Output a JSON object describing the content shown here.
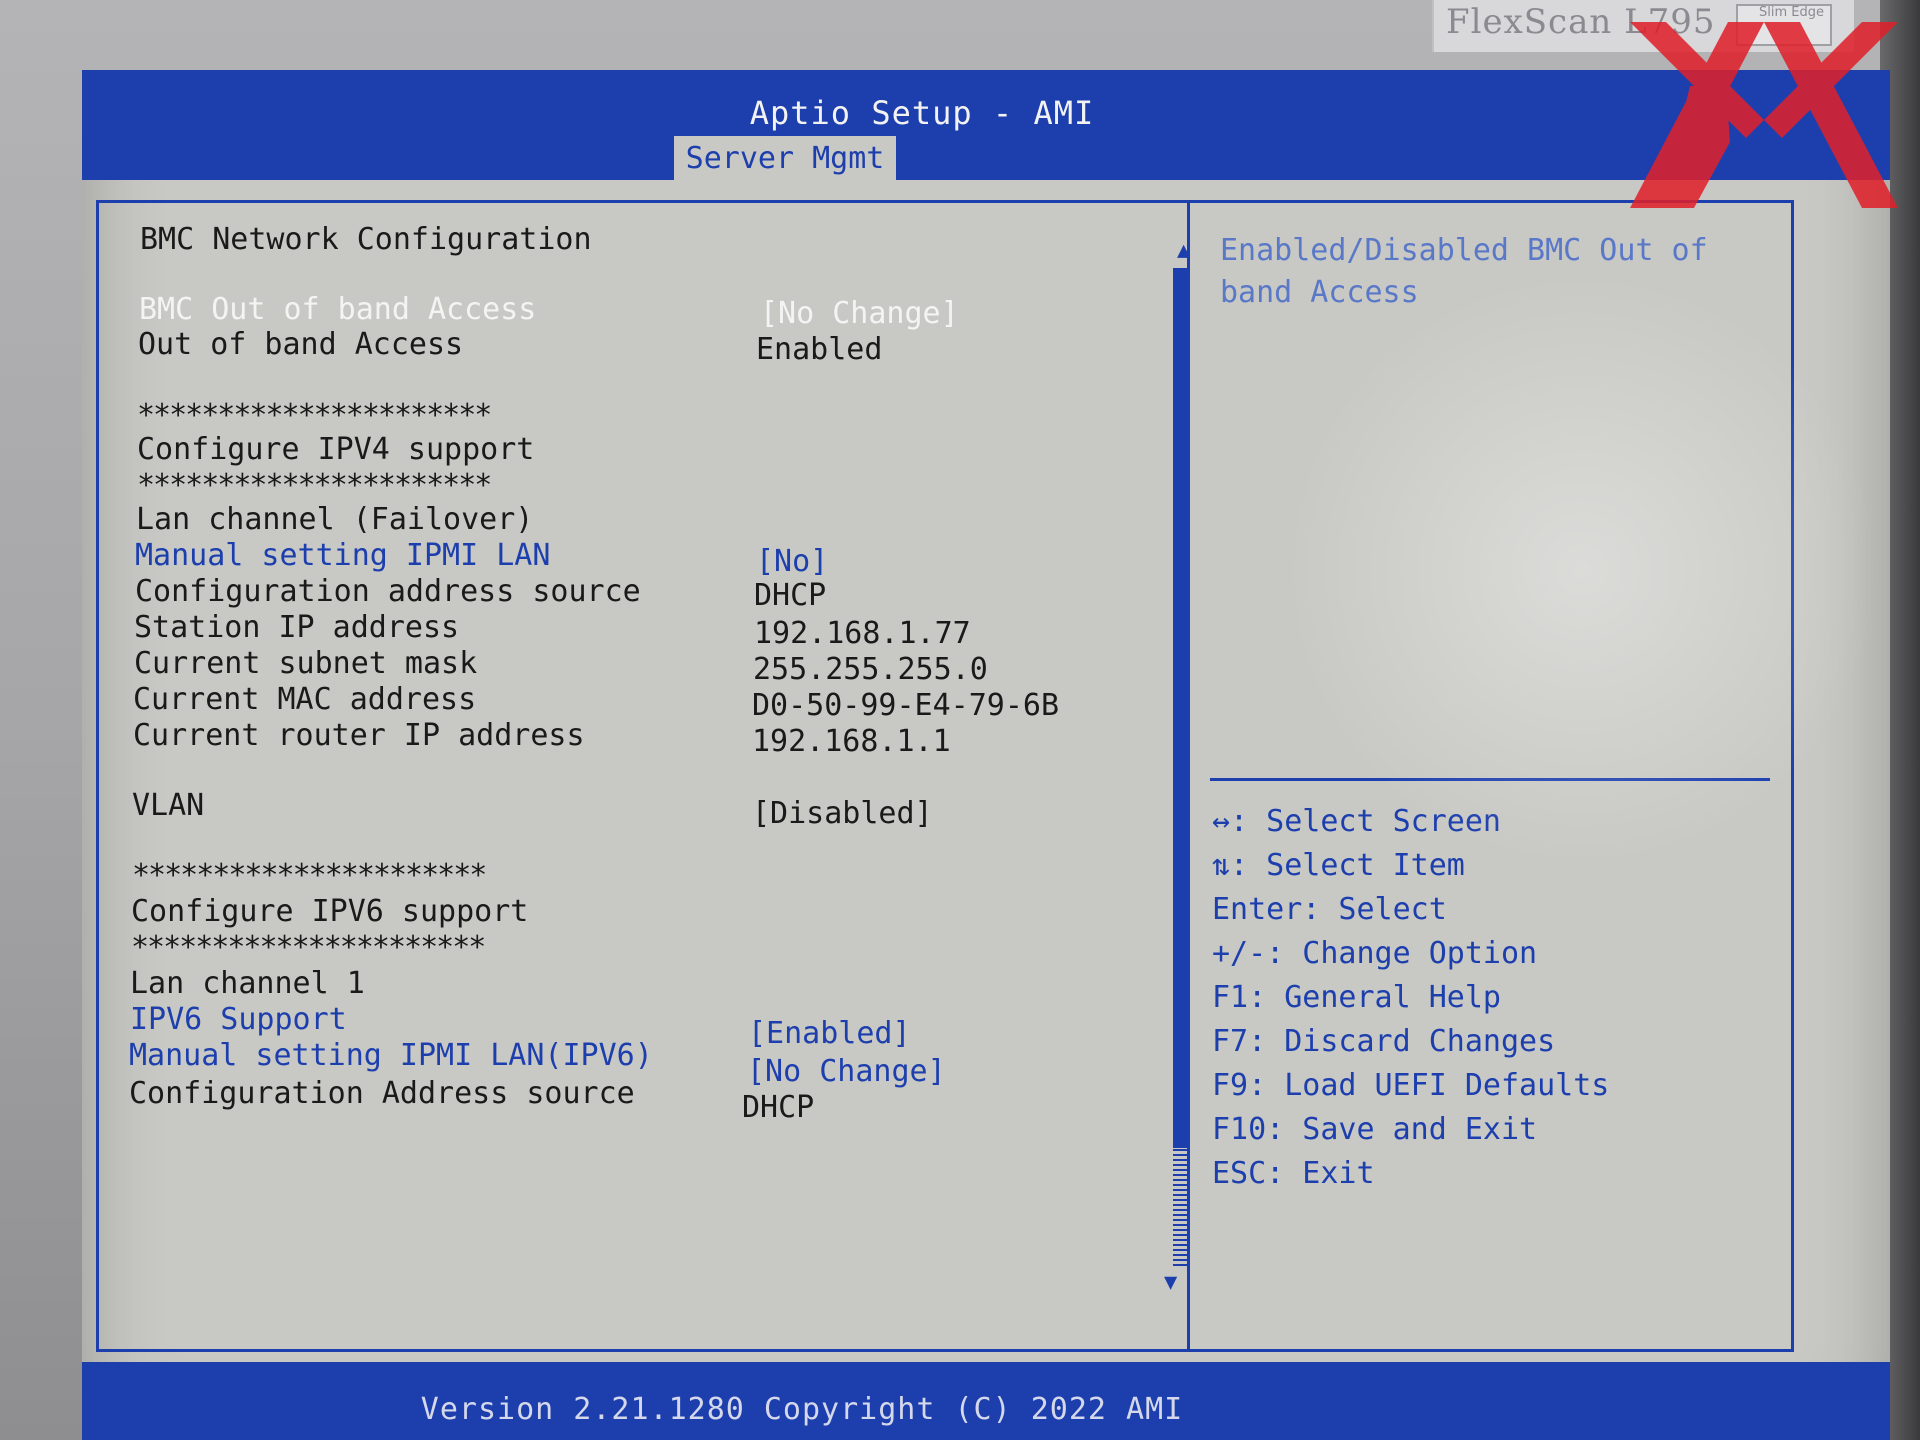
{
  "monitor": {
    "brand": "FlexScan L795",
    "badge": "Slim Edge"
  },
  "watermark": {
    "logo": "xx-logo",
    "color": "#e0202a"
  },
  "header": {
    "title": "Aptio Setup - AMI",
    "active_tab": "Server Mgmt"
  },
  "settings": {
    "section_title": "BMC Network Configuration",
    "rows": [
      {
        "label": "BMC Out of band Access",
        "value": "[No Change]",
        "state": "selected"
      },
      {
        "label": "Out of band Access",
        "value": "Enabled",
        "state": "static"
      },
      {
        "label": "**********************",
        "value": "",
        "state": "static"
      },
      {
        "label": "Configure IPV4 support",
        "value": "",
        "state": "static"
      },
      {
        "label": "**********************",
        "value": "",
        "state": "static"
      },
      {
        "label": "Lan channel (Failover)",
        "value": "",
        "state": "static"
      },
      {
        "label": "Manual setting IPMI LAN",
        "value": "[No]",
        "state": "option"
      },
      {
        "label": "Configuration address source",
        "value": "DHCP",
        "state": "static"
      },
      {
        "label": "Station IP address",
        "value": "192.168.1.77",
        "state": "static"
      },
      {
        "label": "Current subnet mask",
        "value": "255.255.255.0",
        "state": "static"
      },
      {
        "label": "Current MAC address",
        "value": "D0-50-99-E4-79-6B",
        "state": "static"
      },
      {
        "label": "Current router IP address",
        "value": "192.168.1.1",
        "state": "static"
      },
      {
        "label": "VLAN",
        "value": "[Disabled]",
        "state": "static"
      },
      {
        "label": "**********************",
        "value": "",
        "state": "static"
      },
      {
        "label": "Configure IPV6 support",
        "value": "",
        "state": "static"
      },
      {
        "label": "**********************",
        "value": "",
        "state": "static"
      },
      {
        "label": "Lan channel 1",
        "value": "",
        "state": "static"
      },
      {
        "label": "IPV6 Support",
        "value": "[Enabled]",
        "state": "option"
      },
      {
        "label": "Manual setting IPMI LAN(IPV6)",
        "value": "[No Change]",
        "state": "option"
      },
      {
        "label": "Configuration Address source",
        "value": "DHCP",
        "state": "static"
      }
    ]
  },
  "help": {
    "text": "Enabled/Disabled BMC Out of band Access"
  },
  "keys": [
    "↔: Select Screen",
    "⇅: Select Item",
    "Enter: Select",
    "+/-: Change Option",
    "F1: General Help",
    "F7: Discard Changes",
    "F9: Load UEFI Defaults",
    "F10: Save and Exit",
    "ESC: Exit"
  ],
  "footer": {
    "version": "Version 2.21.1280 Copyright (C) 2022 AMI"
  },
  "colors": {
    "bios_blue": "#1d3fae",
    "bios_gray": "#c8c8c4",
    "help_text": "#5a78c8"
  }
}
